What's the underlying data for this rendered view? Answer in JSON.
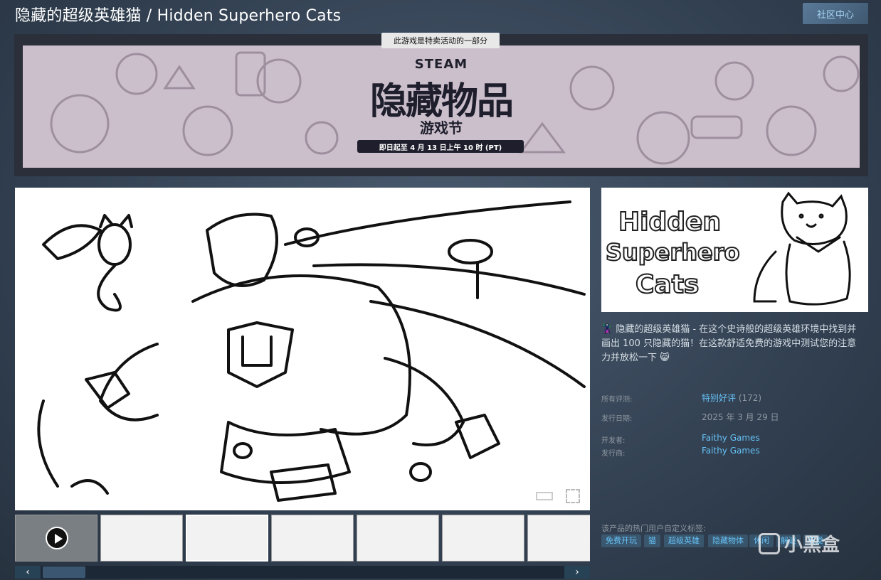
{
  "header": {
    "title": "隐藏的超级英雄猫 / Hidden Superhero Cats",
    "community_button": "社区中心"
  },
  "banner": {
    "sale_tag": "此游戏是特卖活动的一部分",
    "steam": "STEAM",
    "fest_title": "隐藏物品",
    "fest_subtitle": "游戏节",
    "fest_date": "即日起至 4 月 13 日上午 10 时 (PT)"
  },
  "capsule": {
    "line1": "Hidden",
    "line2": "Superhero",
    "line3": "Cats"
  },
  "description": "🦹 隐藏的超级英雄猫 - 在这个史诗般的超级英雄环境中找到并画出 100 只隐藏的猫！在这款舒适免费的游戏中测试您的注意力并放松一下 😸",
  "info": {
    "reviews_label": "所有评测:",
    "reviews_value": "特别好评",
    "reviews_count": "(172)",
    "release_label": "发行日期:",
    "release_value": "2025 年 3 月 29 日",
    "developer_label": "开发者:",
    "developer_value": "Faithy Games",
    "publisher_label": "发行商:",
    "publisher_value": "Faithy Games"
  },
  "tags_label": "该产品的热门用户自定义标签:",
  "tags": [
    "免费开玩",
    "猫",
    "超级英雄",
    "隐藏物体",
    "休闲",
    "解谜",
    "有爱"
  ],
  "scroll": {
    "left": "‹",
    "right": "›"
  },
  "watermark": "小黑盒",
  "colors": {
    "accent": "#67c1f5",
    "background": "#3a4a5c"
  }
}
